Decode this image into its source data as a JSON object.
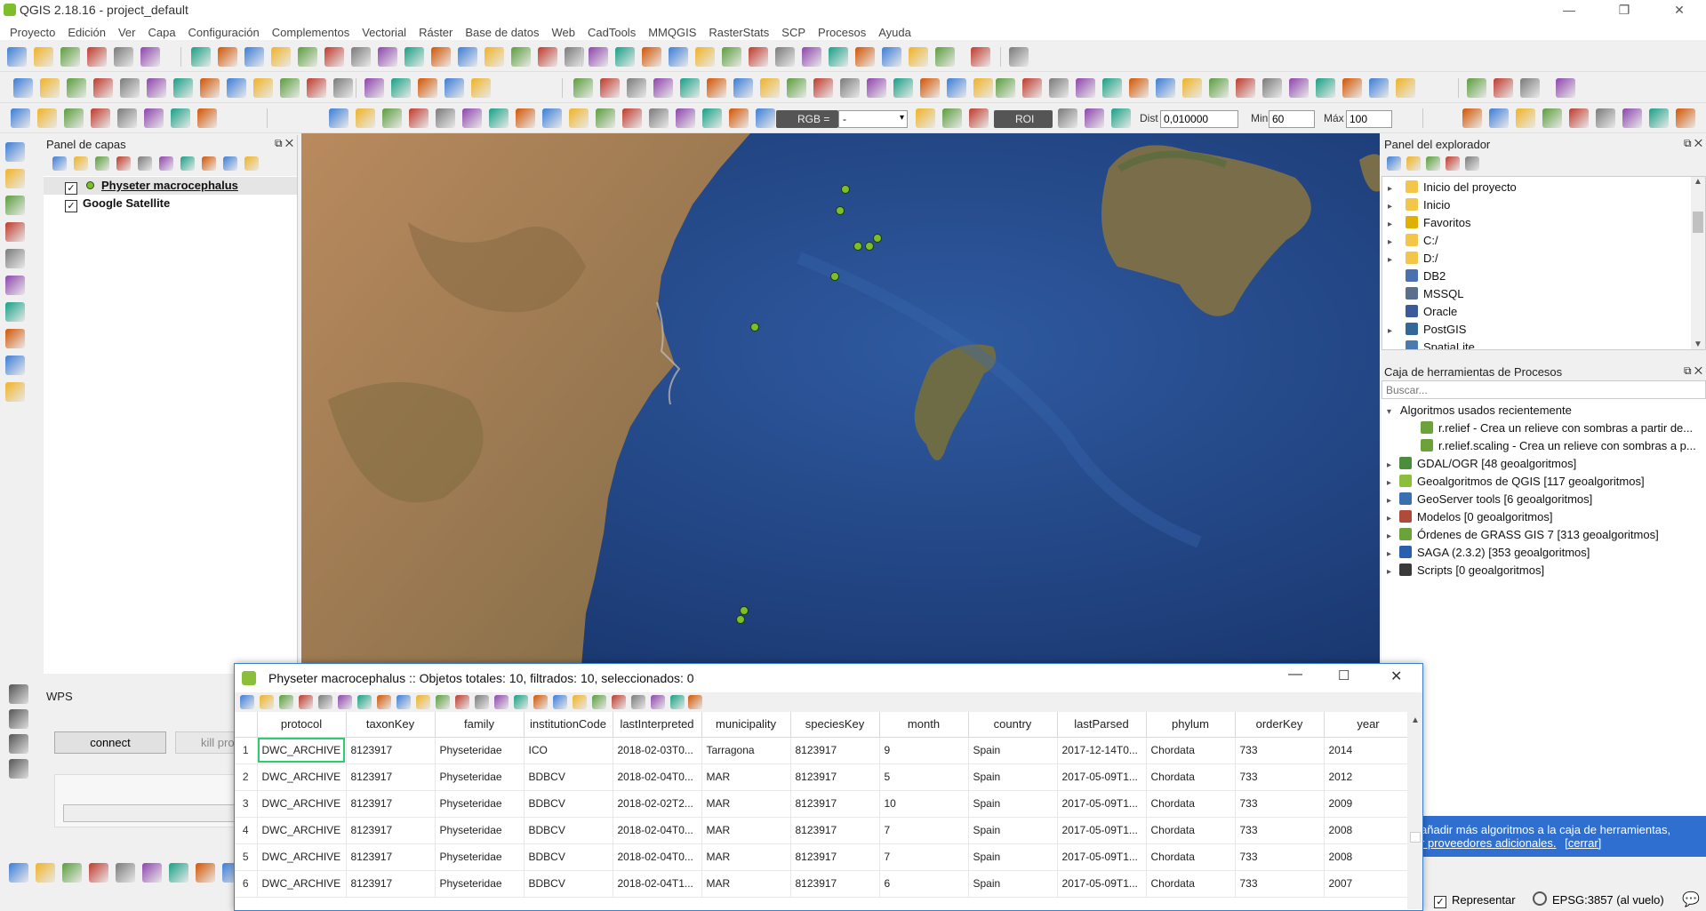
{
  "window": {
    "title": "QGIS 2.18.16 - project_default",
    "minimize": "—",
    "maximize": "❐",
    "close": "✕"
  },
  "menu": [
    "Proyecto",
    "Edición",
    "Ver",
    "Capa",
    "Configuración",
    "Complementos",
    "Vectorial",
    "Ráster",
    "Base de datos",
    "Web",
    "CadTools",
    "MMQGIS",
    "RasterStats",
    "SCP",
    "Procesos",
    "Ayuda"
  ],
  "scp_toolbar": {
    "rgb_label": "RGB =",
    "rgb_value": "-",
    "roi_label": "ROI",
    "dist_label": "Dist",
    "dist_value": "0,010000",
    "min_label": "Min",
    "min_value": "60",
    "max_label": "Máx",
    "max_value": "100"
  },
  "layers_panel": {
    "title": "Panel de capas",
    "layers": [
      {
        "name": "Physeter macrocephalus",
        "checked": true,
        "selected": true,
        "symbol_color": "#7cbf2a"
      },
      {
        "name": "Google Satellite",
        "checked": true,
        "selected": false
      }
    ]
  },
  "wps_panel": {
    "title": "WPS",
    "connect_label": "connect",
    "kill_label": "kill pro"
  },
  "explorer_panel": {
    "title": "Panel del explorador",
    "items": [
      {
        "label": "Inicio del proyecto",
        "icon": "folder-icon",
        "expandable": true
      },
      {
        "label": "Inicio",
        "icon": "folder-icon",
        "expandable": true
      },
      {
        "label": "Favoritos",
        "icon": "star-icon",
        "expandable": true
      },
      {
        "label": "C:/",
        "icon": "folder-icon",
        "expandable": true
      },
      {
        "label": "D:/",
        "icon": "folder-icon",
        "expandable": true
      },
      {
        "label": "DB2",
        "icon": "db2-icon",
        "expandable": false
      },
      {
        "label": "MSSQL",
        "icon": "mssql-icon",
        "expandable": false
      },
      {
        "label": "Oracle",
        "icon": "oracle-icon",
        "expandable": false
      },
      {
        "label": "PostGIS",
        "icon": "postgis-icon",
        "expandable": true
      },
      {
        "label": "SpatiaLite",
        "icon": "spatialite-icon",
        "expandable": false
      }
    ]
  },
  "processing_panel": {
    "title": "Caja de herramientas de Procesos",
    "search_placeholder": "Buscar...",
    "recent_group": "Algoritmos usados recientemente",
    "recent": [
      "r.relief - Crea un relieve con sombras a partir de...",
      "r.relief.scaling - Crea un relieve con sombras a p..."
    ],
    "providers": [
      {
        "label": "GDAL/OGR [48 geoalgoritmos]",
        "color": "#4a8d3a"
      },
      {
        "label": "Geoalgoritmos de QGIS [117 geoalgoritmos]",
        "color": "#8bbf3a"
      },
      {
        "label": "GeoServer tools [6 geoalgoritmos]",
        "color": "#3a6fb0"
      },
      {
        "label": "Modelos [0 geoalgoritmos]",
        "color": "#b04a3a"
      },
      {
        "label": "Órdenes de GRASS GIS 7 [313 geoalgoritmos]",
        "color": "#6aa33a"
      },
      {
        "label": "SAGA (2.3.2) [353 geoalgoritmos]",
        "color": "#2a5fb0"
      },
      {
        "label": "Scripts [0 geoalgoritmos]",
        "color": "#3a3a3a"
      }
    ],
    "info_line1": "añadir más algoritmos a la caja de herramientas,",
    "info_link": "r proveedores adicionales.",
    "info_close": "[cerrar]"
  },
  "statusbar": {
    "render_label": "Representar",
    "crs": "EPSG:3857 (al vuelo)"
  },
  "attribute_table": {
    "title": "Physeter macrocephalus :: Objetos totales: 10, filtrados: 10, seleccionados: 0",
    "columns": [
      "protocol",
      "taxonKey",
      "family",
      "institutionCode",
      "lastInterpreted",
      "municipality",
      "speciesKey",
      "month",
      "country",
      "lastParsed",
      "phylum",
      "orderKey",
      "year"
    ],
    "rows": [
      {
        "n": "1",
        "cells": [
          "DWC_ARCHIVE",
          "8123917",
          "Physeteridae",
          "ICO",
          "2018-02-03T0...",
          "Tarragona",
          "8123917",
          "9",
          "Spain",
          "2017-12-14T0...",
          "Chordata",
          "733",
          "2014"
        ]
      },
      {
        "n": "2",
        "cells": [
          "DWC_ARCHIVE",
          "8123917",
          "Physeteridae",
          "BDBCV",
          "2018-02-04T0...",
          "MAR",
          "8123917",
          "5",
          "Spain",
          "2017-05-09T1...",
          "Chordata",
          "733",
          "2012"
        ]
      },
      {
        "n": "3",
        "cells": [
          "DWC_ARCHIVE",
          "8123917",
          "Physeteridae",
          "BDBCV",
          "2018-02-02T2...",
          "MAR",
          "8123917",
          "10",
          "Spain",
          "2017-05-09T1...",
          "Chordata",
          "733",
          "2009"
        ]
      },
      {
        "n": "4",
        "cells": [
          "DWC_ARCHIVE",
          "8123917",
          "Physeteridae",
          "BDBCV",
          "2018-02-04T0...",
          "MAR",
          "8123917",
          "7",
          "Spain",
          "2017-05-09T1...",
          "Chordata",
          "733",
          "2008"
        ]
      },
      {
        "n": "5",
        "cells": [
          "DWC_ARCHIVE",
          "8123917",
          "Physeteridae",
          "BDBCV",
          "2018-02-04T0...",
          "MAR",
          "8123917",
          "7",
          "Spain",
          "2017-05-09T1...",
          "Chordata",
          "733",
          "2008"
        ]
      },
      {
        "n": "6",
        "cells": [
          "DWC_ARCHIVE",
          "8123917",
          "Physeteridae",
          "BDBCV",
          "2018-02-04T1...",
          "MAR",
          "8123917",
          "6",
          "Spain",
          "2017-05-09T1...",
          "Chordata",
          "733",
          "2007"
        ]
      }
    ]
  }
}
